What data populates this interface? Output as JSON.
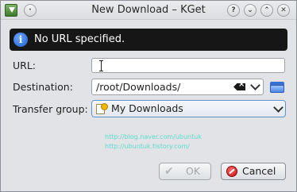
{
  "window": {
    "title": "New Download – KGet",
    "titlebar_buttons": [
      {
        "name": "help-button",
        "glyph": "?"
      },
      {
        "name": "minimize-button",
        "glyph": "⌄"
      },
      {
        "name": "maximize-button",
        "glyph": "⌃"
      },
      {
        "name": "close-button",
        "glyph": "✕"
      }
    ],
    "menu_glyph": "·"
  },
  "banner": {
    "icon": "info-icon",
    "icon_glyph": "i",
    "message": "No URL specified."
  },
  "form": {
    "url_label": "URL:",
    "url_value": "",
    "destination_label": "Destination:",
    "destination_value": "/root/Downloads/",
    "transfer_group_label": "Transfer group:",
    "transfer_group_value": "My Downloads"
  },
  "watermark": {
    "line1": "http://blog.naver.com/ubuntuk",
    "line2": "http://ubuntuk.tistory.com/"
  },
  "buttons": {
    "ok_label": "OK",
    "cancel_label": "Cancel",
    "ok_enabled": false
  },
  "colors": {
    "banner_bg": "#161616",
    "accent": "#5f93cf",
    "watermark": "#5cdccf"
  }
}
